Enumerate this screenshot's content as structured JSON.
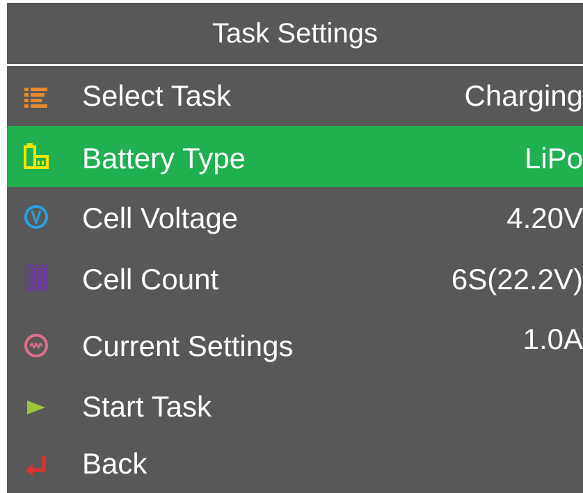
{
  "header": {
    "title": "Task Settings"
  },
  "items": [
    {
      "label": "Select Task",
      "value": "Charging",
      "icon": "list-icon",
      "icon_color": "#e8892b"
    },
    {
      "label": "Battery Type",
      "value": "LiPo",
      "icon": "battery-icon",
      "icon_color": "#f2e600",
      "selected": true
    },
    {
      "label": "Cell Voltage",
      "value": "4.20V",
      "icon": "voltage-icon",
      "icon_color": "#2a9fe0"
    },
    {
      "label": "Cell Count",
      "value": "6S(22.2V)",
      "icon": "cell-grid-icon",
      "icon_color": "#6a3b9a"
    },
    {
      "label": "Current Settings",
      "value": "1.0A",
      "icon": "current-wave-icon",
      "icon_color": "#e0708a"
    },
    {
      "label": "Start Task",
      "value": "",
      "icon": "play-icon",
      "icon_color": "#9bc53d"
    },
    {
      "label": "Back",
      "value": "",
      "icon": "return-arrow-icon",
      "icon_color": "#e03030"
    }
  ],
  "colors": {
    "background": "#585858",
    "selected_row": "#20b050",
    "text": "#ffffff"
  }
}
